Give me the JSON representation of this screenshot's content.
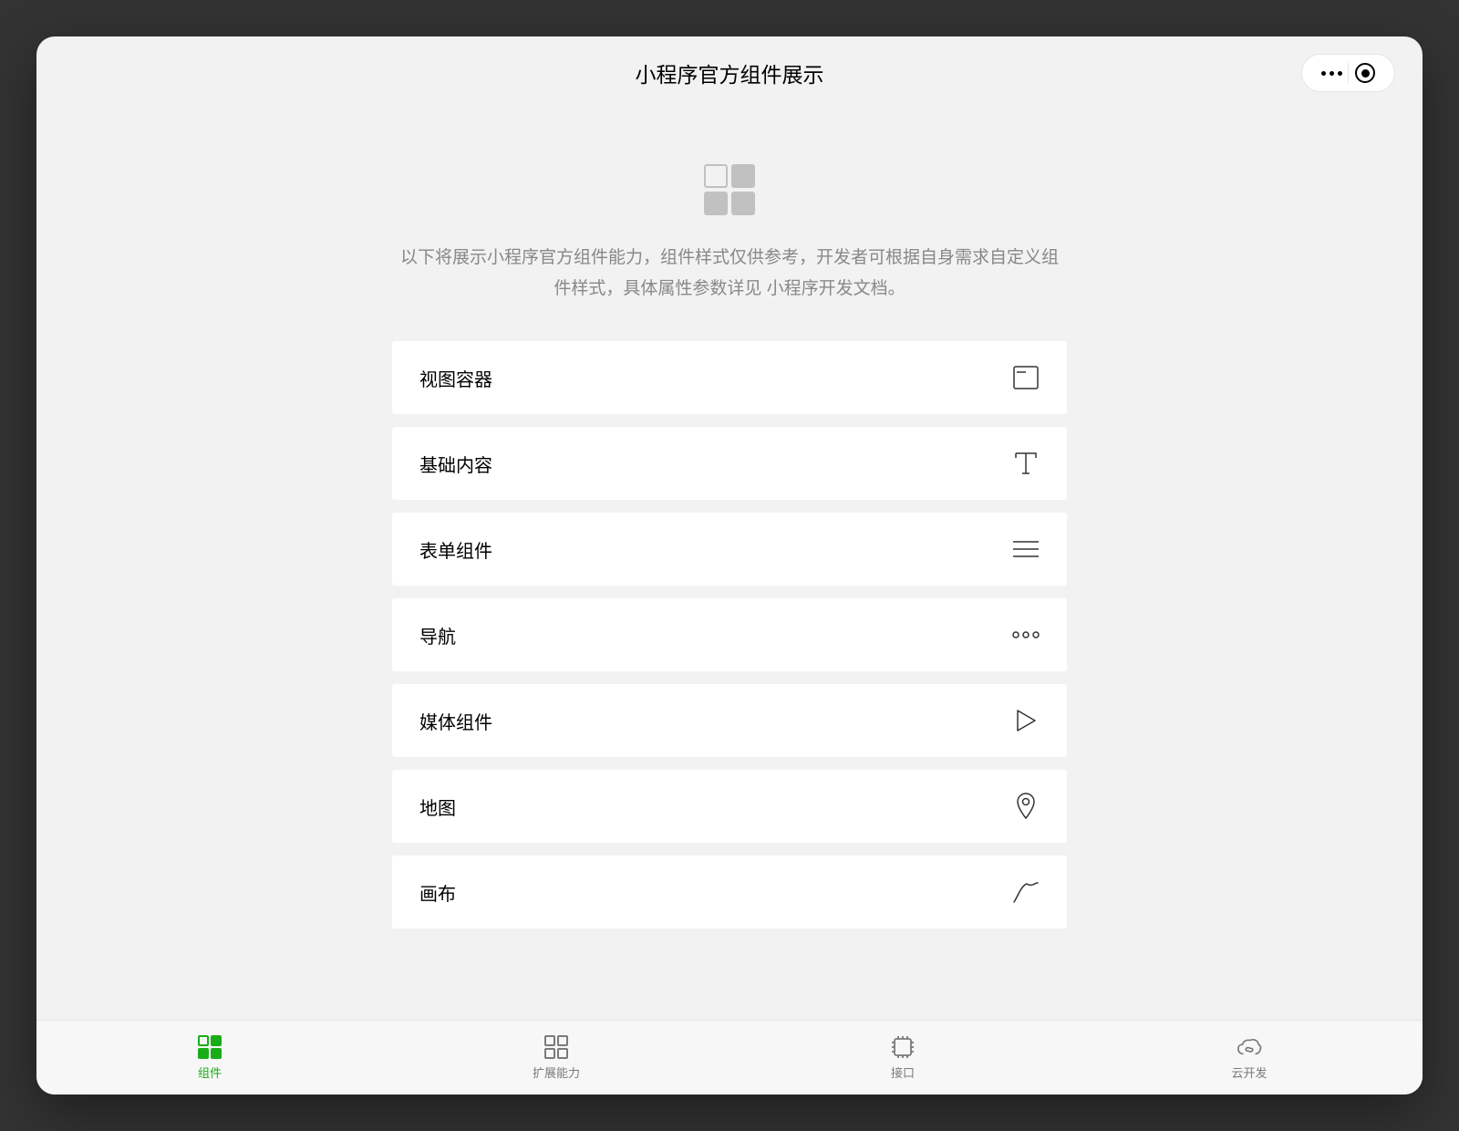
{
  "header": {
    "title": "小程序官方组件展示"
  },
  "hero": {
    "description": "以下将展示小程序官方组件能力，组件样式仅供参考，开发者可根据自身需求自定义组件样式，具体属性参数详见 小程序开发文档。"
  },
  "list": {
    "items": [
      {
        "label": "视图容器",
        "icon": "container-icon"
      },
      {
        "label": "基础内容",
        "icon": "text-icon"
      },
      {
        "label": "表单组件",
        "icon": "form-icon"
      },
      {
        "label": "导航",
        "icon": "nav-icon"
      },
      {
        "label": "媒体组件",
        "icon": "media-icon"
      },
      {
        "label": "地图",
        "icon": "map-icon"
      },
      {
        "label": "画布",
        "icon": "canvas-icon"
      }
    ]
  },
  "tabbar": {
    "tabs": [
      {
        "label": "组件",
        "icon": "components-icon",
        "active": true
      },
      {
        "label": "扩展能力",
        "icon": "extensions-icon",
        "active": false
      },
      {
        "label": "接口",
        "icon": "api-icon",
        "active": false
      },
      {
        "label": "云开发",
        "icon": "cloud-icon",
        "active": false
      }
    ]
  }
}
